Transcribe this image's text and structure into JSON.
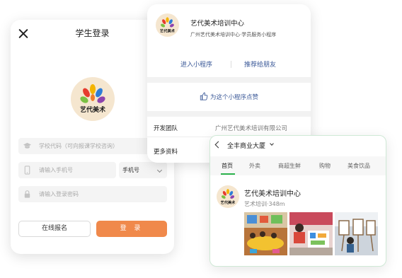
{
  "login": {
    "title": "学生登录",
    "logo_text": "艺代美术",
    "school_placeholder": "学校代码（可向报课学校咨询）",
    "phone_placeholder": "请输入手机号",
    "phone_type": "手机号",
    "password_placeholder": "请输入登录密码",
    "online_signup": "在线报名",
    "login_button": "登 录"
  },
  "mini_program": {
    "name": "艺代美术培训中心",
    "subtitle": "广州艺代美术培训中心·学员服务小程序",
    "enter": "进入小程序",
    "recommend": "推荐给朋友",
    "like": "为这个小程序点赞",
    "developer_label": "开发团队",
    "developer_value": "广州艺代美术培训有限公司",
    "more_label": "更多资料"
  },
  "nearby": {
    "location": "全丰商业大厦",
    "tabs": [
      "首页",
      "外卖",
      "商超生鲜",
      "购物",
      "美食饮品"
    ],
    "active_tab": 0,
    "business_name": "艺代美术培训中心",
    "business_meta": "艺术培训·348m"
  },
  "colors": {
    "accent_orange": "#f0894b",
    "link_blue": "#3b5998",
    "active_green": "#2bb24c"
  },
  "icons": [
    "close-icon",
    "graduation-cap-icon",
    "phone-icon",
    "lock-icon",
    "chevron-down-icon",
    "thumbs-up-icon",
    "back-arrow-icon"
  ]
}
